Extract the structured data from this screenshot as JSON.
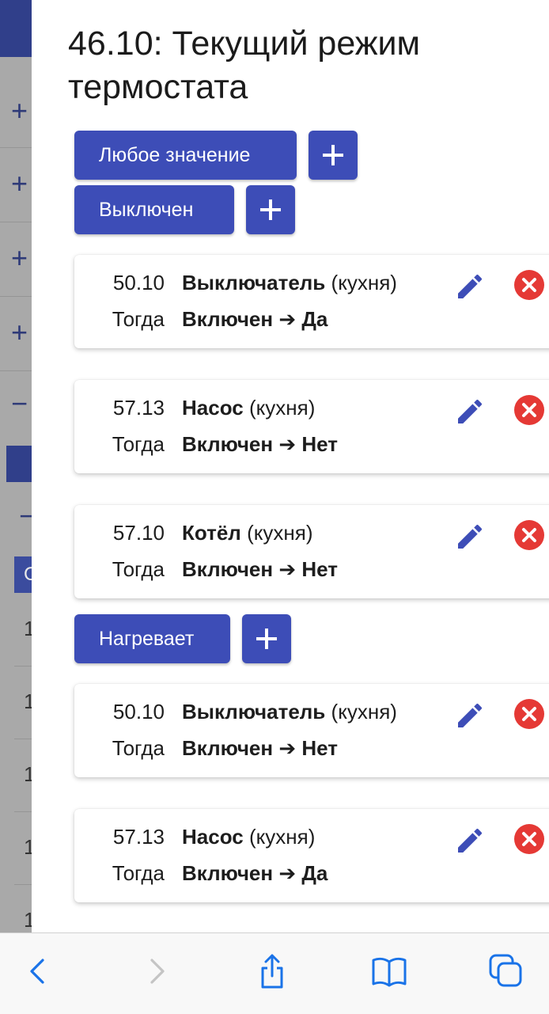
{
  "background": {
    "row_symbols": [
      "+",
      "+",
      "+",
      "+",
      "−"
    ],
    "minus_symbol": "−",
    "table_header_char": "С",
    "row_digits": [
      "1",
      "1",
      "1",
      "1",
      "1"
    ]
  },
  "drawer": {
    "title": "46.10: Текущий режим термостата",
    "sections": [
      {
        "chip_label": "Любое значение",
        "rules": []
      },
      {
        "chip_label": "Выключен",
        "rules": [
          {
            "id": "50.10",
            "device": "Выключатель",
            "room": "(кухня)",
            "then_label": "Тогда",
            "action": "Включен ➔ Да"
          },
          {
            "id": "57.13",
            "device": "Насос",
            "room": "(кухня)",
            "then_label": "Тогда",
            "action": "Включен ➔ Нет"
          },
          {
            "id": "57.10",
            "device": "Котёл",
            "room": "(кухня)",
            "then_label": "Тогда",
            "action": "Включен ➔ Нет"
          }
        ]
      },
      {
        "chip_label": "Нагревает",
        "rules": [
          {
            "id": "50.10",
            "device": "Выключатель",
            "room": "(кухня)",
            "then_label": "Тогда",
            "action": "Включен ➔ Нет"
          },
          {
            "id": "57.13",
            "device": "Насос",
            "room": "(кухня)",
            "then_label": "Тогда",
            "action": "Включен ➔ Да"
          }
        ]
      }
    ],
    "icons": {
      "add": "plus-icon",
      "edit": "pencil-icon",
      "delete": "close-circle-icon"
    }
  },
  "toolbar": {
    "buttons": [
      "back-icon",
      "forward-icon",
      "share-icon",
      "bookmarks-icon",
      "tabs-icon"
    ]
  },
  "colors": {
    "accent": "#3d4db7",
    "delete": "#e53935",
    "ios_blue": "#1a73e8",
    "disabled": "#c4c4c4"
  }
}
